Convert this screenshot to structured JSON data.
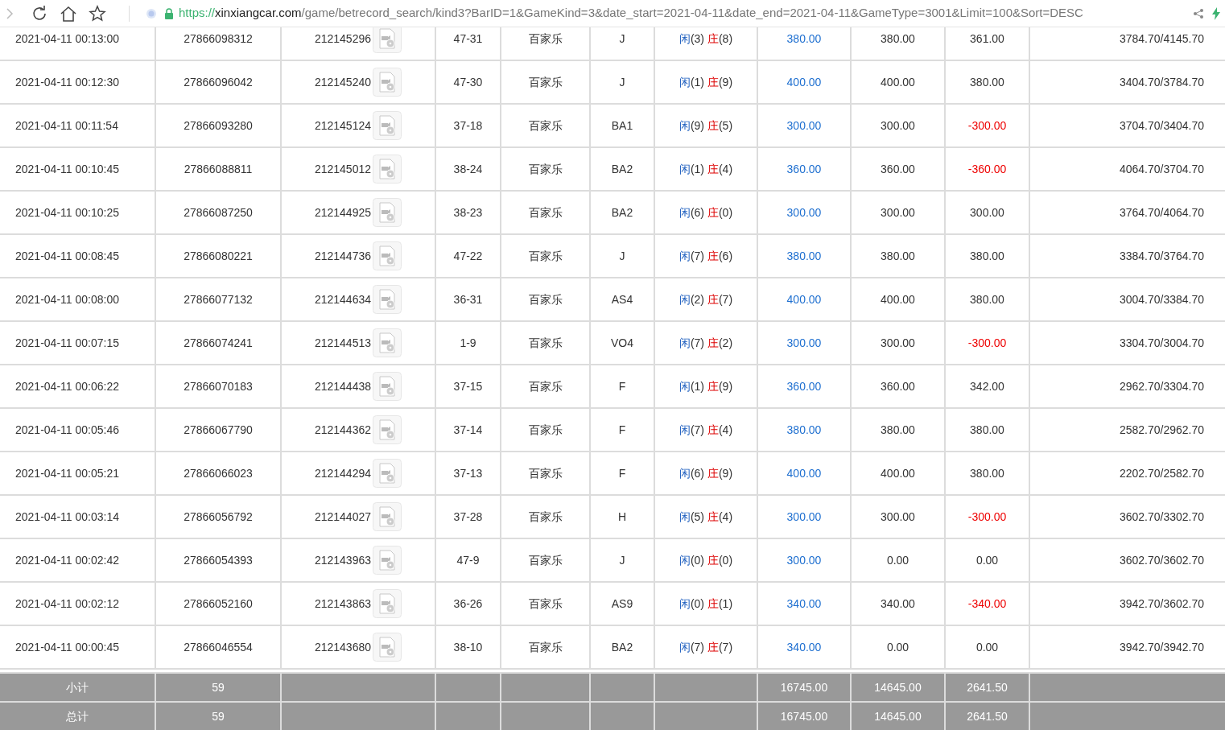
{
  "browser": {
    "url_scheme": "https://",
    "url_host": "xinxiangcar.com",
    "url_path": "/game/betrecord_search/kind3?BarID=1&GameKind=3&date_start=2021-04-11&date_end=2021-04-11&GameType=3001&Limit=100&Sort=DESC"
  },
  "rows": [
    {
      "time": "2021-04-11 00:13:00",
      "bet_id": "27866098312",
      "round_id": "212145296",
      "table": "47-31",
      "game": "百家乐",
      "code": "J",
      "player_label": "闲",
      "player": "(3)",
      "banker_label": "庄",
      "banker": "(8)",
      "bet": "380.00",
      "valid": "380.00",
      "win": "361.00",
      "loss": false,
      "balance": "3784.70/4145.70"
    },
    {
      "time": "2021-04-11 00:12:30",
      "bet_id": "27866096042",
      "round_id": "212145240",
      "table": "47-30",
      "game": "百家乐",
      "code": "J",
      "player_label": "闲",
      "player": "(1)",
      "banker_label": "庄",
      "banker": "(9)",
      "bet": "400.00",
      "valid": "400.00",
      "win": "380.00",
      "loss": false,
      "balance": "3404.70/3784.70"
    },
    {
      "time": "2021-04-11 00:11:54",
      "bet_id": "27866093280",
      "round_id": "212145124",
      "table": "37-18",
      "game": "百家乐",
      "code": "BA1",
      "player_label": "闲",
      "player": "(9)",
      "banker_label": "庄",
      "banker": "(5)",
      "bet": "300.00",
      "valid": "300.00",
      "win": "-300.00",
      "loss": true,
      "balance": "3704.70/3404.70"
    },
    {
      "time": "2021-04-11 00:10:45",
      "bet_id": "27866088811",
      "round_id": "212145012",
      "table": "38-24",
      "game": "百家乐",
      "code": "BA2",
      "player_label": "闲",
      "player": "(1)",
      "banker_label": "庄",
      "banker": "(4)",
      "bet": "360.00",
      "valid": "360.00",
      "win": "-360.00",
      "loss": true,
      "balance": "4064.70/3704.70"
    },
    {
      "time": "2021-04-11 00:10:25",
      "bet_id": "27866087250",
      "round_id": "212144925",
      "table": "38-23",
      "game": "百家乐",
      "code": "BA2",
      "player_label": "闲",
      "player": "(6)",
      "banker_label": "庄",
      "banker": "(0)",
      "bet": "300.00",
      "valid": "300.00",
      "win": "300.00",
      "loss": false,
      "balance": "3764.70/4064.70"
    },
    {
      "time": "2021-04-11 00:08:45",
      "bet_id": "27866080221",
      "round_id": "212144736",
      "table": "47-22",
      "game": "百家乐",
      "code": "J",
      "player_label": "闲",
      "player": "(7)",
      "banker_label": "庄",
      "banker": "(6)",
      "bet": "380.00",
      "valid": "380.00",
      "win": "380.00",
      "loss": false,
      "balance": "3384.70/3764.70"
    },
    {
      "time": "2021-04-11 00:08:00",
      "bet_id": "27866077132",
      "round_id": "212144634",
      "table": "36-31",
      "game": "百家乐",
      "code": "AS4",
      "player_label": "闲",
      "player": "(2)",
      "banker_label": "庄",
      "banker": "(7)",
      "bet": "400.00",
      "valid": "400.00",
      "win": "380.00",
      "loss": false,
      "balance": "3004.70/3384.70"
    },
    {
      "time": "2021-04-11 00:07:15",
      "bet_id": "27866074241",
      "round_id": "212144513",
      "table": "1-9",
      "game": "百家乐",
      "code": "VO4",
      "player_label": "闲",
      "player": "(7)",
      "banker_label": "庄",
      "banker": "(2)",
      "bet": "300.00",
      "valid": "300.00",
      "win": "-300.00",
      "loss": true,
      "balance": "3304.70/3004.70"
    },
    {
      "time": "2021-04-11 00:06:22",
      "bet_id": "27866070183",
      "round_id": "212144438",
      "table": "37-15",
      "game": "百家乐",
      "code": "F",
      "player_label": "闲",
      "player": "(1)",
      "banker_label": "庄",
      "banker": "(9)",
      "bet": "360.00",
      "valid": "360.00",
      "win": "342.00",
      "loss": false,
      "balance": "2962.70/3304.70"
    },
    {
      "time": "2021-04-11 00:05:46",
      "bet_id": "27866067790",
      "round_id": "212144362",
      "table": "37-14",
      "game": "百家乐",
      "code": "F",
      "player_label": "闲",
      "player": "(7)",
      "banker_label": "庄",
      "banker": "(4)",
      "bet": "380.00",
      "valid": "380.00",
      "win": "380.00",
      "loss": false,
      "balance": "2582.70/2962.70"
    },
    {
      "time": "2021-04-11 00:05:21",
      "bet_id": "27866066023",
      "round_id": "212144294",
      "table": "37-13",
      "game": "百家乐",
      "code": "F",
      "player_label": "闲",
      "player": "(6)",
      "banker_label": "庄",
      "banker": "(9)",
      "bet": "400.00",
      "valid": "400.00",
      "win": "380.00",
      "loss": false,
      "balance": "2202.70/2582.70"
    },
    {
      "time": "2021-04-11 00:03:14",
      "bet_id": "27866056792",
      "round_id": "212144027",
      "table": "37-28",
      "game": "百家乐",
      "code": "H",
      "player_label": "闲",
      "player": "(5)",
      "banker_label": "庄",
      "banker": "(4)",
      "bet": "300.00",
      "valid": "300.00",
      "win": "-300.00",
      "loss": true,
      "balance": "3602.70/3302.70"
    },
    {
      "time": "2021-04-11 00:02:42",
      "bet_id": "27866054393",
      "round_id": "212143963",
      "table": "47-9",
      "game": "百家乐",
      "code": "J",
      "player_label": "闲",
      "player": "(0)",
      "banker_label": "庄",
      "banker": "(0)",
      "bet": "300.00",
      "valid": "0.00",
      "win": "0.00",
      "loss": false,
      "balance": "3602.70/3602.70"
    },
    {
      "time": "2021-04-11 00:02:12",
      "bet_id": "27866052160",
      "round_id": "212143863",
      "table": "36-26",
      "game": "百家乐",
      "code": "AS9",
      "player_label": "闲",
      "player": "(0)",
      "banker_label": "庄",
      "banker": "(1)",
      "bet": "340.00",
      "valid": "340.00",
      "win": "-340.00",
      "loss": true,
      "balance": "3942.70/3602.70"
    },
    {
      "time": "2021-04-11 00:00:45",
      "bet_id": "27866046554",
      "round_id": "212143680",
      "table": "38-10",
      "game": "百家乐",
      "code": "BA2",
      "player_label": "闲",
      "player": "(7)",
      "banker_label": "庄",
      "banker": "(7)",
      "bet": "340.00",
      "valid": "0.00",
      "win": "0.00",
      "loss": false,
      "balance": "3942.70/3942.70"
    }
  ],
  "totals": [
    {
      "label": "小计",
      "count": "59",
      "bet": "16745.00",
      "valid": "14645.00",
      "win": "2641.50"
    },
    {
      "label": "总计",
      "count": "59",
      "bet": "16745.00",
      "valid": "14645.00",
      "win": "2641.50"
    }
  ]
}
